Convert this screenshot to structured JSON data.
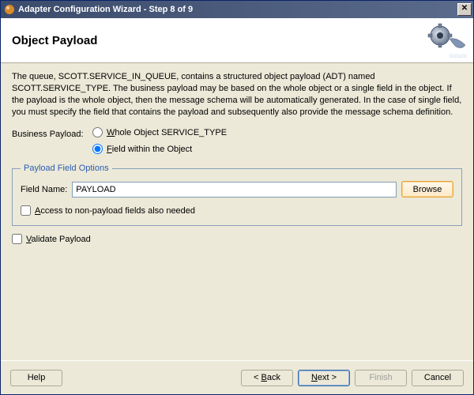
{
  "window": {
    "title": "Adapter Configuration Wizard - Step 8 of 9"
  },
  "header": {
    "title": "Object Payload"
  },
  "description": "The queue, SCOTT.SERVICE_IN_QUEUE, contains a structured object payload (ADT) named SCOTT.SERVICE_TYPE. The business payload may be based on the whole object or a single field in the object. If the payload is the whole object, then the message schema will be automatically generated. In the case of single field, you must specify the field that contains the payload and subsequently also provide the message schema definition.",
  "business_payload": {
    "label": "Business Payload:",
    "whole_object": {
      "label_pre": "W",
      "label_post": "hole Object SERVICE_TYPE",
      "checked": false
    },
    "field_within": {
      "label_pre": "F",
      "label_post": "ield within the Object",
      "checked": true
    }
  },
  "payload_field_options": {
    "legend": "Payload Field Options",
    "field_name_label": "Field Name:",
    "field_name_value": "PAYLOAD",
    "browse_label": "Browse",
    "access_pre": "A",
    "access_post": "ccess to non-payload fields also needed",
    "access_checked": false
  },
  "validate": {
    "pre": "V",
    "post": "alidate Payload",
    "checked": false
  },
  "footer": {
    "help": "Help",
    "back": "< Back",
    "next": "Next >",
    "finish": "Finish",
    "cancel": "Cancel"
  }
}
